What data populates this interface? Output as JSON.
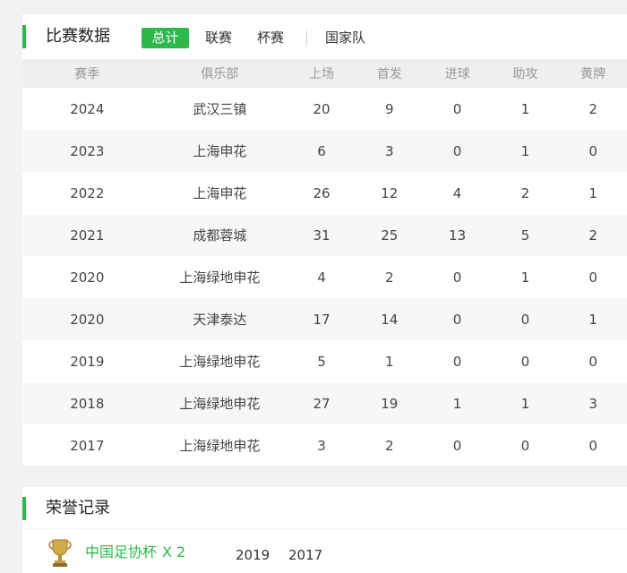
{
  "stats": {
    "title": "比赛数据",
    "tabs": [
      "总计",
      "联赛",
      "杯赛",
      "国家队"
    ],
    "active_tab": "总计",
    "columns": [
      "赛季",
      "俱乐部",
      "上场",
      "首发",
      "进球",
      "助攻",
      "黄牌"
    ],
    "rows": [
      [
        "2024",
        "武汉三镇",
        "20",
        "9",
        "0",
        "1",
        "2"
      ],
      [
        "2023",
        "上海申花",
        "6",
        "3",
        "0",
        "1",
        "0"
      ],
      [
        "2022",
        "上海申花",
        "26",
        "12",
        "4",
        "2",
        "1"
      ],
      [
        "2021",
        "成都蓉城",
        "31",
        "25",
        "13",
        "5",
        "2"
      ],
      [
        "2020",
        "上海绿地申花",
        "4",
        "2",
        "0",
        "1",
        "0"
      ],
      [
        "2020",
        "天津泰达",
        "17",
        "14",
        "0",
        "0",
        "1"
      ],
      [
        "2019",
        "上海绿地申花",
        "5",
        "1",
        "0",
        "0",
        "0"
      ],
      [
        "2018",
        "上海绿地申花",
        "27",
        "19",
        "1",
        "1",
        "3"
      ],
      [
        "2017",
        "上海绿地申花",
        "3",
        "2",
        "0",
        "0",
        "0"
      ]
    ]
  },
  "honors": {
    "title": "荣誉记录",
    "items": [
      {
        "icon": "trophy-icon",
        "name": "中国足协杯",
        "count": "X 2",
        "years": [
          "2019",
          "2017"
        ]
      }
    ]
  },
  "colors": {
    "accent": "#2db84c",
    "header_bg": "#efefef",
    "alt_row_bg": "#f7f7f7",
    "page_bg": "#f2f2f2"
  }
}
